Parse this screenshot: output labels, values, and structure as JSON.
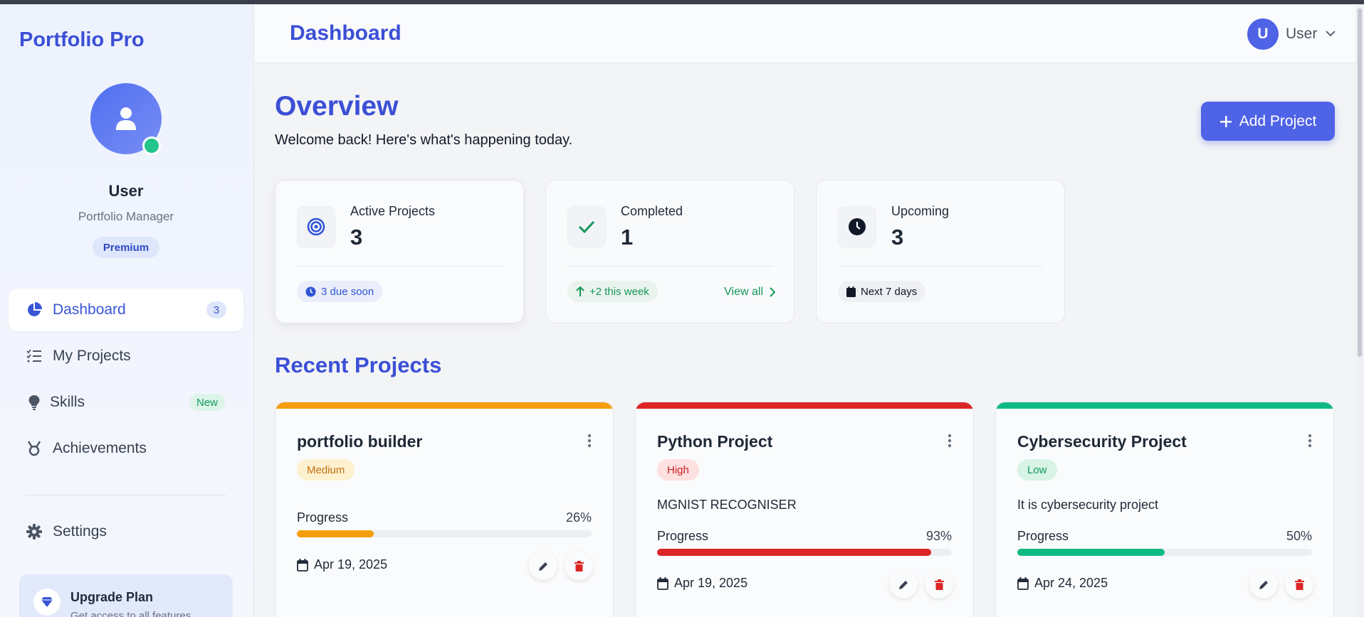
{
  "colors": {
    "accent": "#3b4fd6",
    "primary_button": "#4f63e6",
    "online": "#22c58b",
    "medium": "#f59e0b",
    "high": "#dc2626",
    "low": "#10b981"
  },
  "sidebar": {
    "brand": "Portfolio Pro",
    "user_name": "User",
    "user_role": "Portfolio Manager",
    "plan_badge": "Premium",
    "items": [
      {
        "label": "Dashboard",
        "icon": "pie-chart-icon",
        "count": "3",
        "active": true
      },
      {
        "label": "My Projects",
        "icon": "task-list-icon"
      },
      {
        "label": "Skills",
        "icon": "lightbulb-icon",
        "tag": "New"
      },
      {
        "label": "Achievements",
        "icon": "medal-icon"
      },
      {
        "label": "Settings",
        "icon": "gear-icon"
      }
    ],
    "upgrade": {
      "title": "Upgrade Plan",
      "subtitle": "Get access to all features",
      "icon": "diamond-icon"
    }
  },
  "header": {
    "title": "Dashboard",
    "avatar_letter": "U",
    "user_label": "User"
  },
  "overview": {
    "title": "Overview",
    "subtitle": "Welcome back! Here's what's happening today.",
    "add_button": "Add Project"
  },
  "stats": [
    {
      "label": "Active Projects",
      "value": "3",
      "icon": "target-icon",
      "chip": "3 due soon"
    },
    {
      "label": "Completed",
      "value": "1",
      "icon": "check-icon",
      "chip": "+2 this week",
      "link": "View all"
    },
    {
      "label": "Upcoming",
      "value": "3",
      "icon": "clock-icon",
      "chip": "Next 7 days"
    }
  ],
  "recent": {
    "title": "Recent Projects",
    "progress_label": "Progress",
    "projects": [
      {
        "title": "portfolio builder",
        "priority": "Medium",
        "description": "",
        "progress": 26,
        "progress_text": "26%",
        "date": "Apr 19, 2025"
      },
      {
        "title": "Python Project",
        "priority": "High",
        "description": "MGNIST RECOGNISER",
        "progress": 93,
        "progress_text": "93%",
        "date": "Apr 19, 2025"
      },
      {
        "title": "Cybersecurity Project",
        "priority": "Low",
        "description": "It is cybersecurity project",
        "progress": 50,
        "progress_text": "50%",
        "date": "Apr 24, 2025"
      }
    ]
  }
}
